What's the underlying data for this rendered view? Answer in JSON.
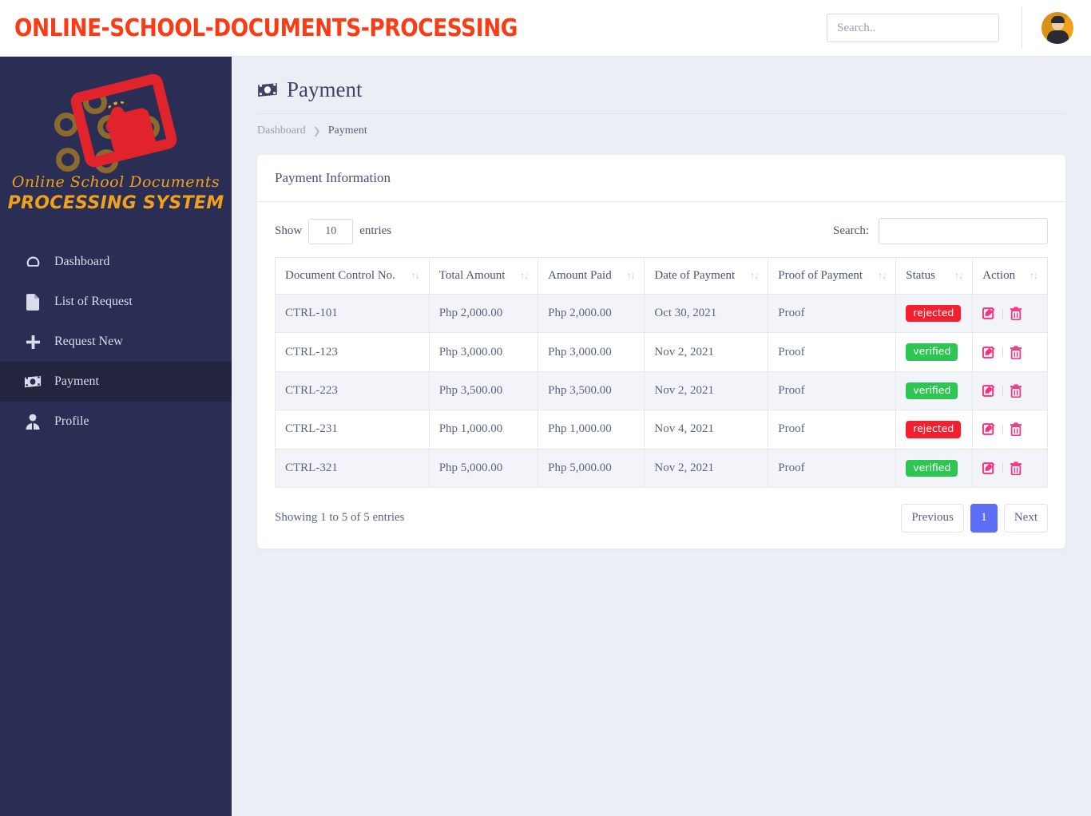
{
  "topbar": {
    "brand_title": "ONLINE-SCHOOL-DOCUMENTS-PROCESSING",
    "brand_color": "#fb3b14",
    "search_placeholder": "Search..",
    "search_value": "",
    "avatar_name": "user-avatar"
  },
  "sidebar": {
    "background": "#2b2e54",
    "active_background": "#23253f",
    "logo": {
      "script_text": "Online School Documents",
      "bold_text": "PROCESSING SYSTEM",
      "accent_color": "#f0a019",
      "tablet_color": "#e1232c"
    },
    "items": [
      {
        "label": "Dashboard",
        "icon": "speedometer-icon",
        "active": false
      },
      {
        "label": "List of Request",
        "icon": "document-icon",
        "active": false
      },
      {
        "label": "Request New",
        "icon": "plus-icon",
        "active": false
      },
      {
        "label": "Payment",
        "icon": "money-icon",
        "active": true
      },
      {
        "label": "Profile",
        "icon": "person-icon",
        "active": false
      }
    ]
  },
  "page": {
    "title": "Payment",
    "title_icon": "money-icon",
    "breadcrumb": {
      "parent": "Dashboard",
      "separator": "❯",
      "current": "Payment"
    }
  },
  "card": {
    "header": "Payment Information",
    "controls": {
      "show_label": "Show",
      "entries_value": "10",
      "entries_label": "entries",
      "search_label": "Search:",
      "search_value": ""
    },
    "table": {
      "columns": [
        "Document Control No.",
        "Total Amount",
        "Amount Paid",
        "Date of Payment",
        "Proof of Payment",
        "Status",
        "Action"
      ],
      "sort_icon": "↑↓",
      "rows": [
        {
          "control_no": "CTRL-101",
          "total_amount": "Php 2,000.00",
          "amount_paid": "Php 2,000.00",
          "date": "Oct 30, 2021",
          "proof": "Proof",
          "status": "rejected",
          "status_color": "#f4202f"
        },
        {
          "control_no": "CTRL-123",
          "total_amount": "Php 3,000.00",
          "amount_paid": "Php 3,000.00",
          "date": "Nov 2, 2021",
          "proof": "Proof",
          "status": "verified",
          "status_color": "#2dc653"
        },
        {
          "control_no": "CTRL-223",
          "total_amount": "Php 3,500.00",
          "amount_paid": "Php 3,500.00",
          "date": "Nov 2, 2021",
          "proof": "Proof",
          "status": "verified",
          "status_color": "#2dc653"
        },
        {
          "control_no": "CTRL-231",
          "total_amount": "Php 1,000.00",
          "amount_paid": "Php 1,000.00",
          "date": "Nov 4, 2021",
          "proof": "Proof",
          "status": "rejected",
          "status_color": "#f4202f"
        },
        {
          "control_no": "CTRL-321",
          "total_amount": "Php 5,000.00",
          "amount_paid": "Php 5,000.00",
          "date": "Nov 2, 2021",
          "proof": "Proof",
          "status": "verified",
          "status_color": "#2dc653"
        }
      ],
      "action_separator": "|"
    },
    "footer": {
      "showing_text": "Showing 1 to 5 of 5 entries",
      "pagination": {
        "previous": "Previous",
        "pages": [
          "1"
        ],
        "active_page": "1",
        "next": "Next",
        "active_color": "#5b6ef5"
      }
    }
  }
}
